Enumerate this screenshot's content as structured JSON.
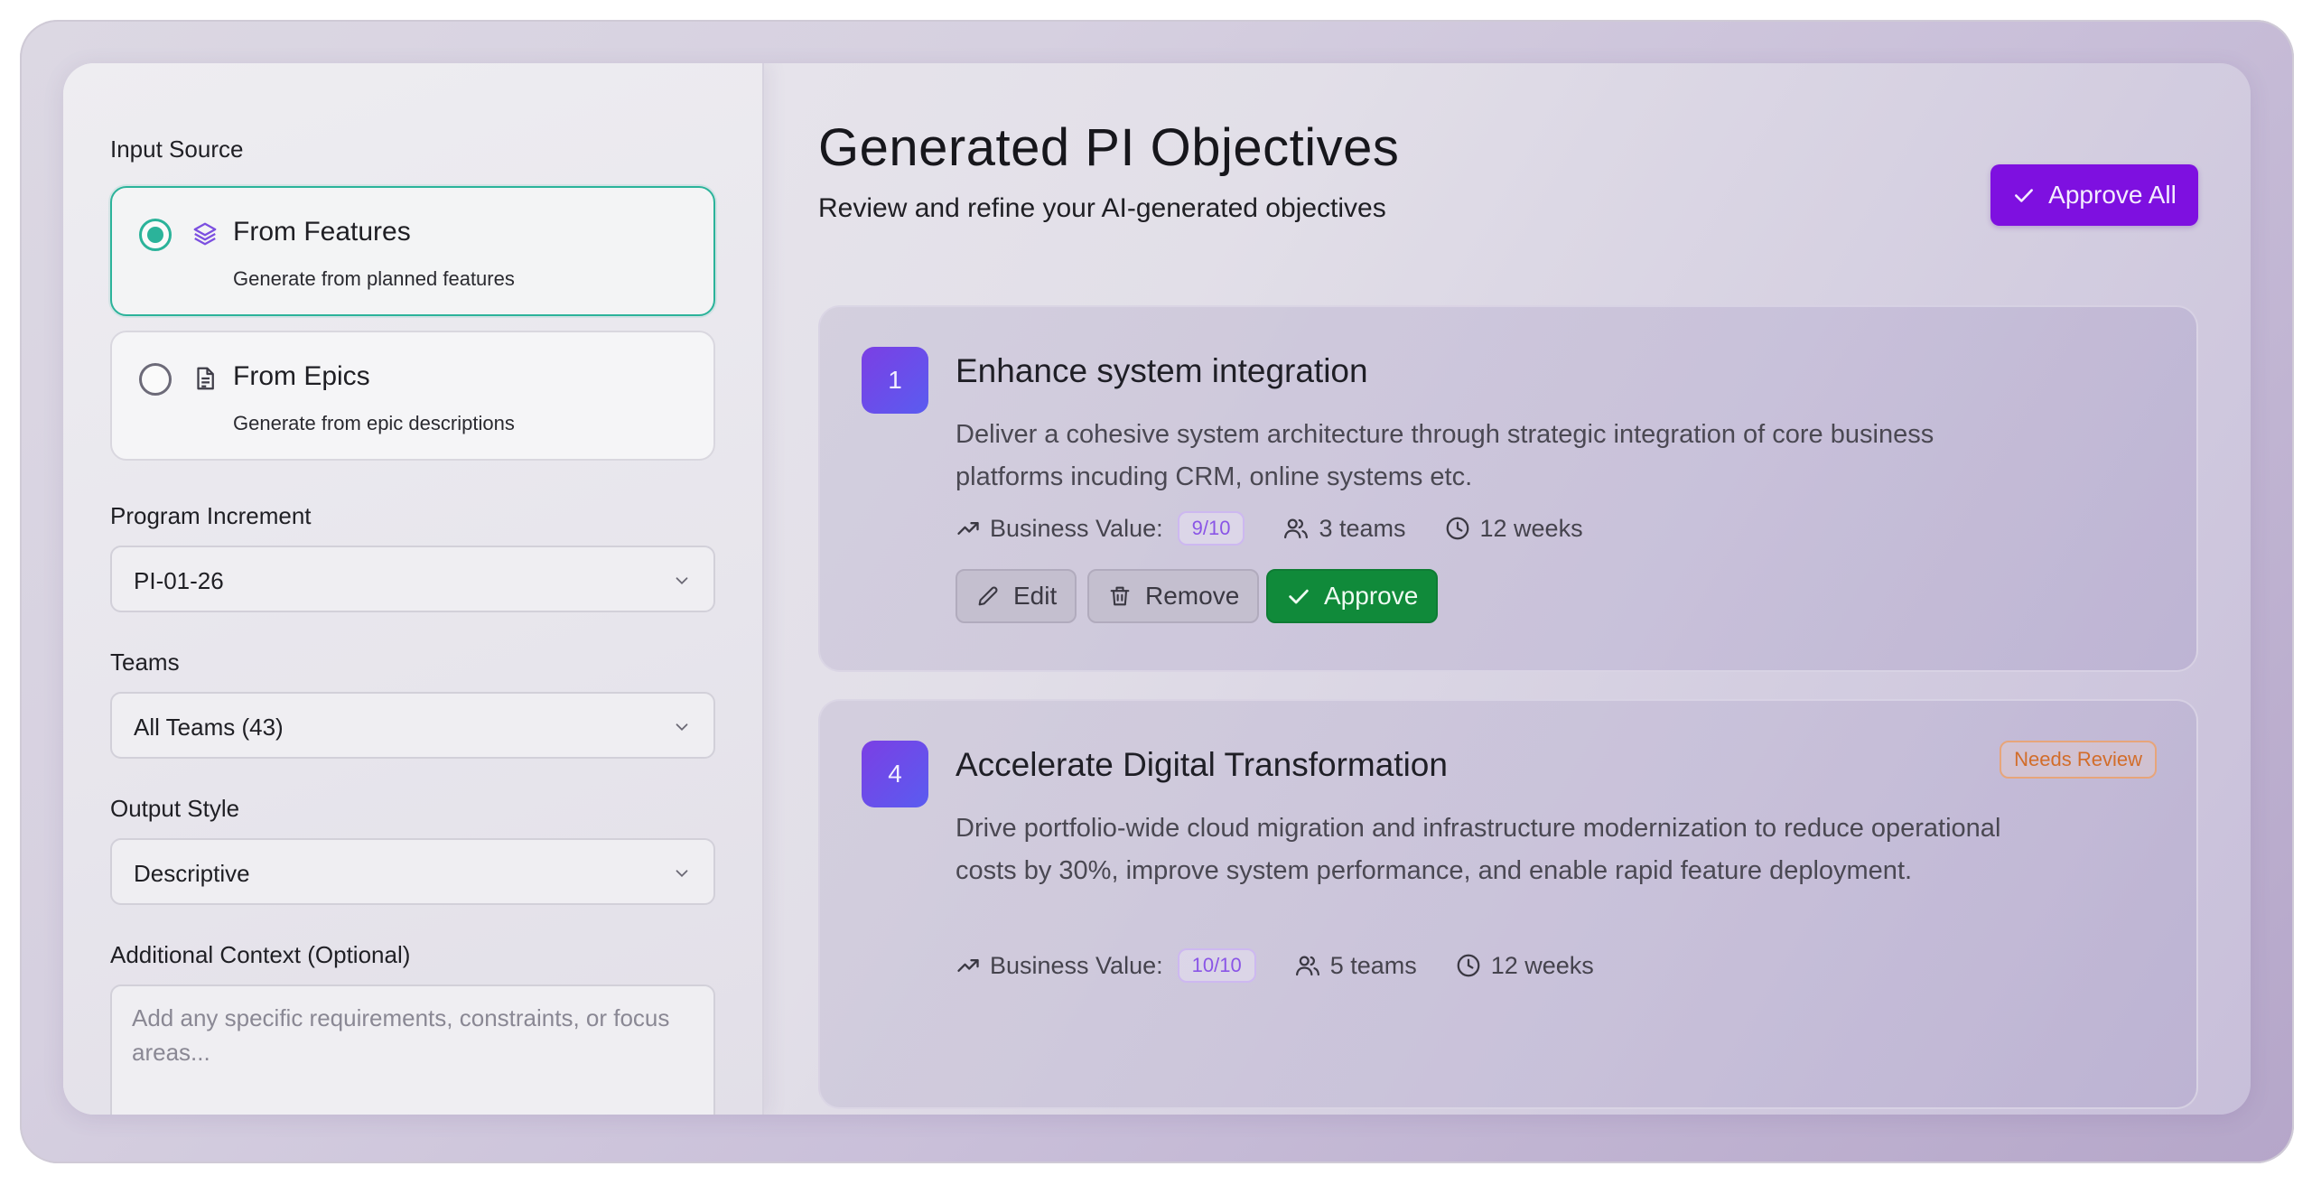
{
  "sidebar": {
    "input_source_label": "Input Source",
    "sources": [
      {
        "title": "From Features",
        "subtitle": "Generate from planned features",
        "selected": true,
        "icon": "layers-icon"
      },
      {
        "title": "From Epics",
        "subtitle": "Generate from epic descriptions",
        "selected": false,
        "icon": "document-icon"
      }
    ],
    "program_increment": {
      "label": "Program Increment",
      "value": "PI-01-26"
    },
    "teams": {
      "label": "Teams",
      "value": "All Teams (43)"
    },
    "output_style": {
      "label": "Output Style",
      "value": "Descriptive"
    },
    "additional_context": {
      "label": "Additional Context (Optional)",
      "placeholder": "Add any specific requirements, constraints, or focus areas..."
    }
  },
  "main": {
    "title": "Generated PI Objectives",
    "subtitle": "Review and refine your AI-generated objectives",
    "approve_all_label": "Approve All",
    "objectives": [
      {
        "number": "1",
        "title": "Enhance system integration",
        "description": "Deliver a cohesive system architecture through strategic integration of core business platforms incuding CRM, online systems etc.",
        "business_value_label": "Business Value:",
        "business_value": "9/10",
        "teams": "3 teams",
        "duration": "12 weeks",
        "actions": {
          "edit": "Edit",
          "remove": "Remove",
          "approve": "Approve"
        }
      },
      {
        "number": "4",
        "title": "Accelerate Digital Transformation",
        "description": "Drive portfolio-wide cloud migration and infrastructure modernization to reduce operational costs by 30%, improve system performance, and enable rapid feature deployment.",
        "business_value_label": "Business Value:",
        "business_value": "10/10",
        "teams": "5 teams",
        "duration": "12 weeks",
        "status": "Needs Review"
      }
    ]
  },
  "colors": {
    "accent_purple": "#7e10e0",
    "selected_teal": "#2bb39a",
    "approve_green": "#108a3a",
    "warning_orange": "#d26d2a"
  }
}
